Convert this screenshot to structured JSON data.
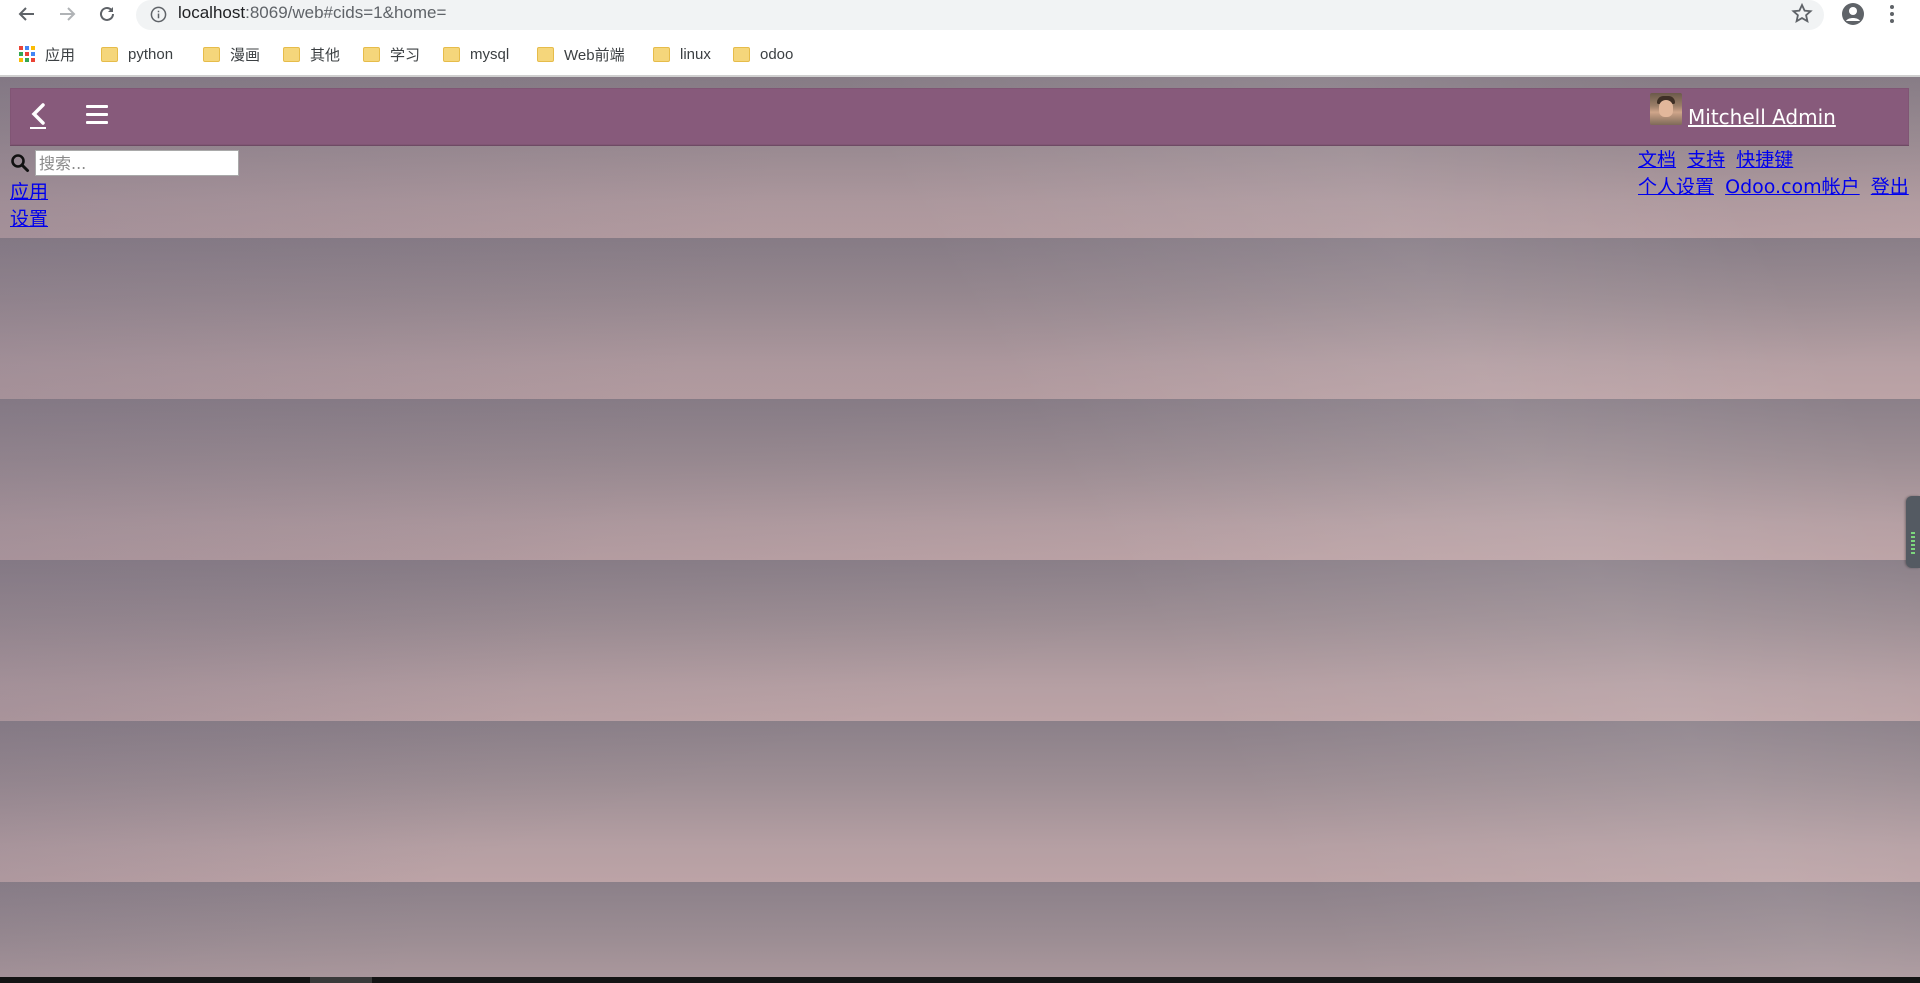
{
  "browser": {
    "url_host": "localhost",
    "url_rest": ":8069/web#cids=1&home=",
    "bookmarks": [
      {
        "label": "应用",
        "icon": "apps-grid-icon"
      },
      {
        "label": "python",
        "icon": "folder-icon"
      },
      {
        "label": "漫画",
        "icon": "folder-icon"
      },
      {
        "label": "其他",
        "icon": "folder-icon"
      },
      {
        "label": "学习",
        "icon": "folder-icon"
      },
      {
        "label": "mysql",
        "icon": "folder-icon"
      },
      {
        "label": "Web前端",
        "icon": "folder-icon"
      },
      {
        "label": "linux",
        "icon": "folder-icon"
      },
      {
        "label": "odoo",
        "icon": "folder-icon"
      }
    ]
  },
  "topbar": {
    "back_icon": "chevron-left-icon",
    "menu_icon": "hamburger-menu-icon",
    "user_name": " Mitchell Admin",
    "bar_color": "#875a7b"
  },
  "search": {
    "icon": "search-icon",
    "placeholder": "搜索..."
  },
  "left_menu": {
    "items": [
      "应用",
      "设置"
    ]
  },
  "user_menu": {
    "row1": [
      "文档",
      "支持",
      "快捷键"
    ],
    "row2": [
      "个人设置",
      "Odoo.com帐户",
      "登出"
    ]
  }
}
